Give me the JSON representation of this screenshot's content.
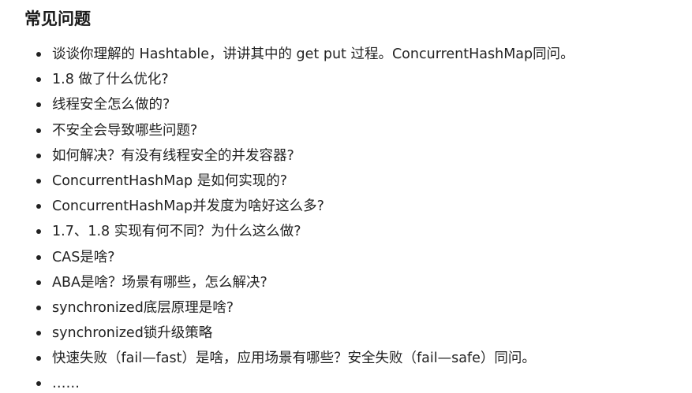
{
  "section": {
    "title": "常见问题",
    "questions": [
      "谈谈你理解的 Hashtable，讲讲其中的 get put 过程。ConcurrentHashMap同问。",
      "1.8 做了什么优化?",
      "线程安全怎么做的?",
      "不安全会导致哪些问题?",
      "如何解决？有没有线程安全的并发容器?",
      "ConcurrentHashMap 是如何实现的?",
      "ConcurrentHashMap并发度为啥好这么多?",
      "1.7、1.8 实现有何不同？为什么这么做?",
      "CAS是啥?",
      "ABA是啥？场景有哪些，怎么解决?",
      "synchronized底层原理是啥?",
      "synchronized锁升级策略",
      "快速失败（fail—fast）是啥，应用场景有哪些？安全失败（fail—safe）同问。",
      "……"
    ]
  }
}
